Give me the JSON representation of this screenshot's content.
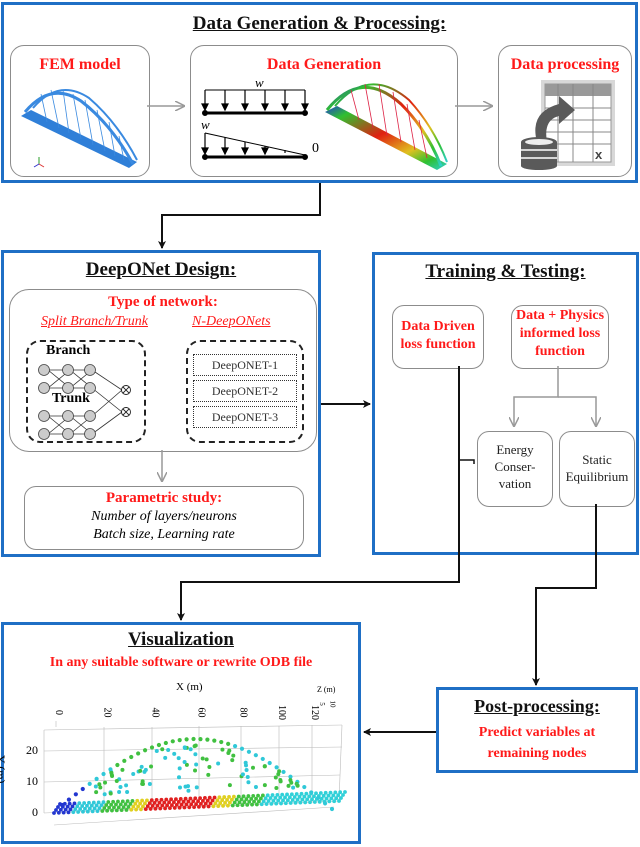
{
  "data_generation": {
    "title": "Data Generation & Processing:",
    "fem_model": {
      "label": "FEM model"
    },
    "generation": {
      "label": "Data Generation",
      "load_symbol": "w",
      "zero_label": "0"
    },
    "processing": {
      "label": "Data processing",
      "excel_glyph": "x"
    }
  },
  "deeponet": {
    "title": "DeepONet Design:",
    "network_type": {
      "label": "Type of network:",
      "option_split": "Split Branch/Trunk",
      "option_n": "N-DeepONets",
      "branch_label": "Branch",
      "trunk_label": "Trunk",
      "n_models": [
        "DeepONET-1",
        "DeepONET-2",
        "DeepONET-3"
      ]
    },
    "parametric": {
      "label": "Parametric study:",
      "line1": "Number of layers/neurons",
      "line2": "Batch size, Learning rate"
    }
  },
  "training": {
    "title": "Training & Testing:",
    "data_driven": {
      "line1": "Data Driven",
      "line2": "loss function"
    },
    "physics": {
      "line1": "Data + Physics",
      "line2": "informed loss",
      "line3": "function"
    },
    "energy": {
      "line1": "Energy",
      "line2": "Conser-",
      "line3": "vation"
    },
    "static": {
      "line1": "Static",
      "line2": "Equilibrium"
    }
  },
  "visualization": {
    "title": "Visualization",
    "subtitle": "In any suitable software or rewrite ODB file",
    "plot": {
      "xlabel": "X (m)",
      "ylabel": "Y (m)",
      "zlabel": "Z (m)",
      "x_ticks": [
        "0",
        "20",
        "40",
        "60",
        "80",
        "100",
        "120"
      ],
      "y_ticks": [
        "0",
        "10",
        "20"
      ],
      "z_ticks": [
        "5",
        "10"
      ]
    }
  },
  "post_processing": {
    "title": "Post-processing:",
    "line1": "Predict variables at",
    "line2": "remaining nodes"
  },
  "colors": {
    "box_border": "#1f6fc5",
    "highlight": "#ff1a1a",
    "connector": "#111111",
    "inner_arrow": "#999999"
  }
}
